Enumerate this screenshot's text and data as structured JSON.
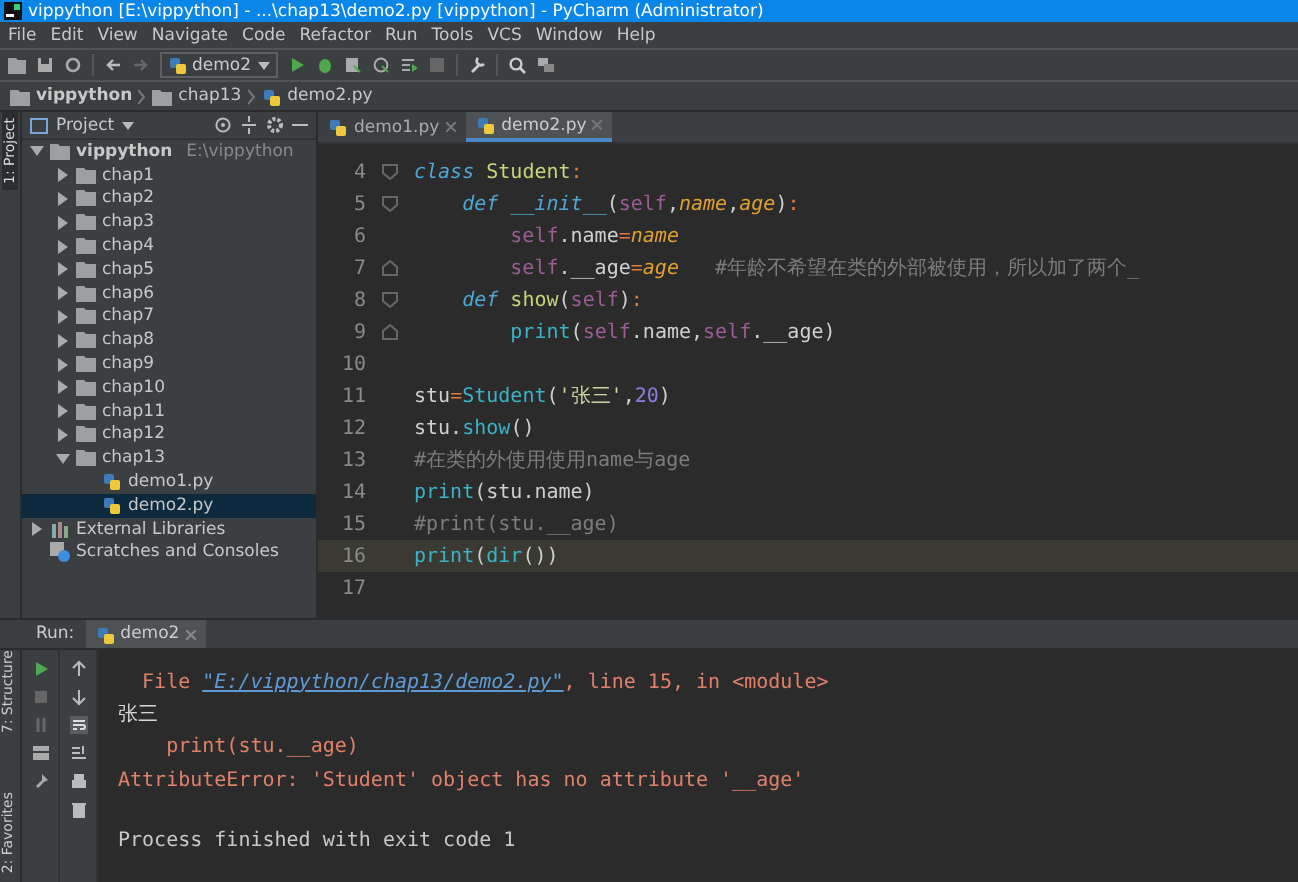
{
  "window": {
    "title": "vippython [E:\\vippython] - ...\\chap13\\demo2.py [vippython] - PyCharm (Administrator)"
  },
  "menu": [
    "File",
    "Edit",
    "View",
    "Navigate",
    "Code",
    "Refactor",
    "Run",
    "Tools",
    "VCS",
    "Window",
    "Help"
  ],
  "toolbar": {
    "run_config": "demo2"
  },
  "breadcrumb": [
    "vippython",
    "chap13",
    "demo2.py"
  ],
  "side_strip": {
    "top": "1: Project",
    "bottom": [
      "7: Structure",
      "2: Favorites"
    ]
  },
  "project": {
    "title": "Project",
    "tree": [
      {
        "label": "vippython",
        "path": "E:\\vippython",
        "kind": "project",
        "expanded": true,
        "selected": false,
        "children": [
          {
            "label": "chap1",
            "kind": "folder",
            "expanded": false,
            "selected": false
          },
          {
            "label": "chap2",
            "kind": "folder",
            "expanded": false,
            "selected": false
          },
          {
            "label": "chap3",
            "kind": "folder",
            "expanded": false,
            "selected": false
          },
          {
            "label": "chap4",
            "kind": "folder",
            "expanded": false,
            "selected": false
          },
          {
            "label": "chap5",
            "kind": "folder",
            "expanded": false,
            "selected": false
          },
          {
            "label": "chap6",
            "kind": "folder",
            "expanded": false,
            "selected": false
          },
          {
            "label": "chap7",
            "kind": "folder",
            "expanded": false,
            "selected": false
          },
          {
            "label": "chap8",
            "kind": "folder",
            "expanded": false,
            "selected": false
          },
          {
            "label": "chap9",
            "kind": "folder",
            "expanded": false,
            "selected": false
          },
          {
            "label": "chap10",
            "kind": "folder",
            "expanded": false,
            "selected": false
          },
          {
            "label": "chap11",
            "kind": "folder",
            "expanded": false,
            "selected": false
          },
          {
            "label": "chap12",
            "kind": "folder",
            "expanded": false,
            "selected": false
          },
          {
            "label": "chap13",
            "kind": "folder",
            "expanded": true,
            "selected": false,
            "children": [
              {
                "label": "demo1.py",
                "kind": "file",
                "selected": false
              },
              {
                "label": "demo2.py",
                "kind": "file",
                "selected": true
              }
            ]
          }
        ]
      },
      {
        "label": "External Libraries",
        "kind": "libraries",
        "expanded": false,
        "selected": false
      },
      {
        "label": "Scratches and Consoles",
        "kind": "scratches",
        "selected": false
      }
    ]
  },
  "editor": {
    "tabs": [
      {
        "label": "demo1.py",
        "selected": false
      },
      {
        "label": "demo2.py",
        "selected": true
      }
    ],
    "lines": [
      {
        "number": "4",
        "current": false,
        "fold_open": true,
        "fold_close": false,
        "tokens": [
          {
            "text": "class",
            "kind": "kw"
          },
          {
            "text": " Student",
            "kind": "cls"
          },
          {
            "text": ":",
            "kind": "punc"
          }
        ]
      },
      {
        "number": "5",
        "current": false,
        "fold_open": true,
        "fold_close": false,
        "tokens": [
          {
            "text": "    def",
            "kind": "kw"
          },
          {
            "text": " __init__",
            "kind": "kw"
          },
          {
            "text": "(",
            "kind": "plain"
          },
          {
            "text": "self",
            "kind": "self"
          },
          {
            "text": ",",
            "kind": "plain"
          },
          {
            "text": "name",
            "kind": "param"
          },
          {
            "text": ",",
            "kind": "plain"
          },
          {
            "text": "age",
            "kind": "param"
          },
          {
            "text": ")",
            "kind": "plain"
          },
          {
            "text": ":",
            "kind": "punc"
          }
        ]
      },
      {
        "number": "6",
        "current": false,
        "fold_open": false,
        "fold_close": false,
        "tokens": [
          {
            "text": "        self",
            "kind": "self"
          },
          {
            "text": ".name",
            "kind": "plain"
          },
          {
            "text": "=",
            "kind": "punc"
          },
          {
            "text": "name",
            "kind": "param"
          }
        ]
      },
      {
        "number": "7",
        "current": false,
        "fold_open": false,
        "fold_close": true,
        "tokens": [
          {
            "text": "        self",
            "kind": "self"
          },
          {
            "text": ".__age",
            "kind": "plain"
          },
          {
            "text": "=",
            "kind": "punc"
          },
          {
            "text": "age",
            "kind": "param"
          },
          {
            "text": "   #年龄不希望在类的外部被使用，所以加了两个_",
            "kind": "comment"
          }
        ]
      },
      {
        "number": "8",
        "current": false,
        "fold_open": true,
        "fold_close": false,
        "tokens": [
          {
            "text": "    def",
            "kind": "kw"
          },
          {
            "text": " show",
            "kind": "fn"
          },
          {
            "text": "(",
            "kind": "plain"
          },
          {
            "text": "self",
            "kind": "self"
          },
          {
            "text": ")",
            "kind": "plain"
          },
          {
            "text": ":",
            "kind": "punc"
          }
        ]
      },
      {
        "number": "9",
        "current": false,
        "fold_open": false,
        "fold_close": true,
        "tokens": [
          {
            "text": "        print",
            "kind": "builtin"
          },
          {
            "text": "(",
            "kind": "plain"
          },
          {
            "text": "self",
            "kind": "self"
          },
          {
            "text": ".name,",
            "kind": "plain"
          },
          {
            "text": "self",
            "kind": "self"
          },
          {
            "text": ".__age)",
            "kind": "plain"
          }
        ]
      },
      {
        "number": "10",
        "current": false,
        "fold_open": false,
        "fold_close": false
      },
      {
        "number": "11",
        "current": false,
        "fold_open": false,
        "fold_close": false,
        "tokens": [
          {
            "text": "stu",
            "kind": "plain"
          },
          {
            "text": "=",
            "kind": "punc"
          },
          {
            "text": "Student",
            "kind": "builtin"
          },
          {
            "text": "(",
            "kind": "plain"
          },
          {
            "text": "'张三'",
            "kind": "str"
          },
          {
            "text": ",",
            "kind": "plain"
          },
          {
            "text": "20",
            "kind": "num"
          },
          {
            "text": ")",
            "kind": "plain"
          }
        ]
      },
      {
        "number": "12",
        "current": false,
        "fold_open": false,
        "fold_close": false,
        "tokens": [
          {
            "text": "stu.",
            "kind": "plain"
          },
          {
            "text": "show",
            "kind": "builtin"
          },
          {
            "text": "()",
            "kind": "plain"
          }
        ]
      },
      {
        "number": "13",
        "current": false,
        "fold_open": false,
        "fold_close": false,
        "tokens": [
          {
            "text": "#在类的外使用使用name与age",
            "kind": "comment"
          }
        ]
      },
      {
        "number": "14",
        "current": false,
        "fold_open": false,
        "fold_close": false,
        "tokens": [
          {
            "text": "print",
            "kind": "builtin"
          },
          {
            "text": "(stu.name)",
            "kind": "plain"
          }
        ]
      },
      {
        "number": "15",
        "current": false,
        "fold_open": false,
        "fold_close": false,
        "tokens": [
          {
            "text": "#print(stu.__age)",
            "kind": "comment"
          }
        ]
      },
      {
        "number": "16",
        "current": true,
        "fold_open": false,
        "fold_close": false,
        "tokens": [
          {
            "text": "print",
            "kind": "builtin"
          },
          {
            "text": "(",
            "kind": "plain"
          },
          {
            "text": "dir",
            "kind": "builtin"
          },
          {
            "text": "())",
            "kind": "plain"
          }
        ]
      },
      {
        "number": "17",
        "current": false,
        "fold_open": false,
        "fold_close": false
      }
    ]
  },
  "run": {
    "label": "Run:",
    "tab": "demo2",
    "output": [
      {
        "kind": "stderr",
        "tokens": [
          {
            "text": "  File ",
            "kind": "text"
          },
          {
            "text": "\"E:/vippython/chap13/demo2.py\"",
            "kind": "link"
          },
          {
            "text": ", line 15, in <module>",
            "kind": "text"
          }
        ]
      },
      {
        "kind": "stdout",
        "tokens": [
          {
            "text": "张三",
            "kind": "text"
          }
        ]
      },
      {
        "kind": "stderr",
        "tokens": [
          {
            "text": "    print(stu.__age)",
            "kind": "text"
          }
        ]
      },
      {
        "kind": "stderr",
        "tokens": [
          {
            "text": "AttributeError: 'Student' object has no attribute '__age'",
            "kind": "text"
          }
        ]
      },
      {
        "kind": "system",
        "tokens": [
          {
            "text": "Process finished with exit code 1",
            "kind": "text"
          }
        ]
      }
    ]
  }
}
